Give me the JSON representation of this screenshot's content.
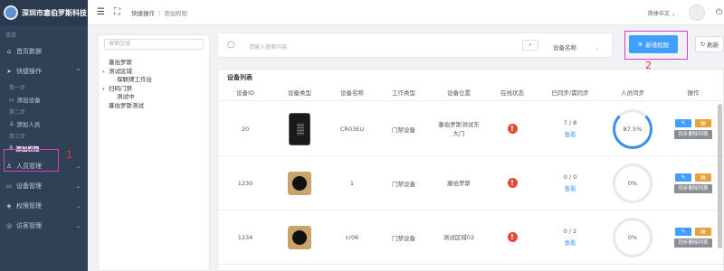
{
  "brand": {
    "title": "深圳市塞伯罗斯科技"
  },
  "sidebar": {
    "section_label": "菜单",
    "items": [
      {
        "label": "首页数据",
        "icon": "home-icon"
      },
      {
        "label": "快捷操作",
        "icon": "send-icon"
      },
      {
        "label": "人员管理",
        "icon": "user-icon"
      },
      {
        "label": "设备管理",
        "icon": "device-icon"
      },
      {
        "label": "权限管理",
        "icon": "shield-icon"
      },
      {
        "label": "访客管理",
        "icon": "visitor-icon"
      }
    ],
    "steps": [
      {
        "step": "第一步",
        "label": "添加设备"
      },
      {
        "step": "第二步",
        "label": "添加人员"
      },
      {
        "step": "第三步",
        "label": "添加权限"
      }
    ]
  },
  "header": {
    "breadcrumb_root": "快捷操作",
    "breadcrumb_current": "添加权限",
    "language": "简体中文"
  },
  "tree": {
    "search_placeholder": "搜索区域",
    "nodes": [
      {
        "label": "塞伯罗斯",
        "level": 0,
        "toggle": ""
      },
      {
        "label": "测试区域",
        "level": 0,
        "toggle": "▾"
      },
      {
        "label": "保联牌工作台",
        "level": 1,
        "toggle": ""
      },
      {
        "label": "扫码门禁",
        "level": 0,
        "toggle": "▾"
      },
      {
        "label": "测试中",
        "level": 1,
        "toggle": ""
      },
      {
        "label": "塞伯罗斯测试",
        "level": 0,
        "toggle": ""
      }
    ]
  },
  "search": {
    "placeholder": "请输入搜索内容",
    "select_value": "设备名称"
  },
  "actions": {
    "add_label": "新增权限",
    "refresh_label": "刷新"
  },
  "annotations": {
    "one": "1",
    "two": "2"
  },
  "table": {
    "title": "设备列表",
    "columns": [
      "设备ID",
      "设备类型",
      "设备名称",
      "工作类型",
      "设备位置",
      "在线状态",
      "已同步/需同步",
      "人员同步",
      "操作"
    ],
    "rows": [
      {
        "id": "20",
        "name": "CR03EU",
        "work_type": "门禁设备",
        "location": "塞伯罗斯测试东大门",
        "online": "!",
        "sync_count": "7 / 8",
        "view": "查看",
        "percent": "87.5%",
        "sync_label": "同步删除列表",
        "round": false
      },
      {
        "id": "1230",
        "name": "1",
        "work_type": "门禁设备",
        "location": "塞伯罗斯",
        "online": "!",
        "sync_count": "0 / 0",
        "view": "查看",
        "percent": "0%",
        "sync_label": "同步删除列表",
        "round": true
      },
      {
        "id": "1234",
        "name": "cr06",
        "work_type": "门禁设备",
        "location": "测试区域02",
        "online": "!",
        "sync_count": "0 / 2",
        "view": "查看",
        "percent": "0%",
        "sync_label": "同步删除列表",
        "round": true
      }
    ]
  }
}
